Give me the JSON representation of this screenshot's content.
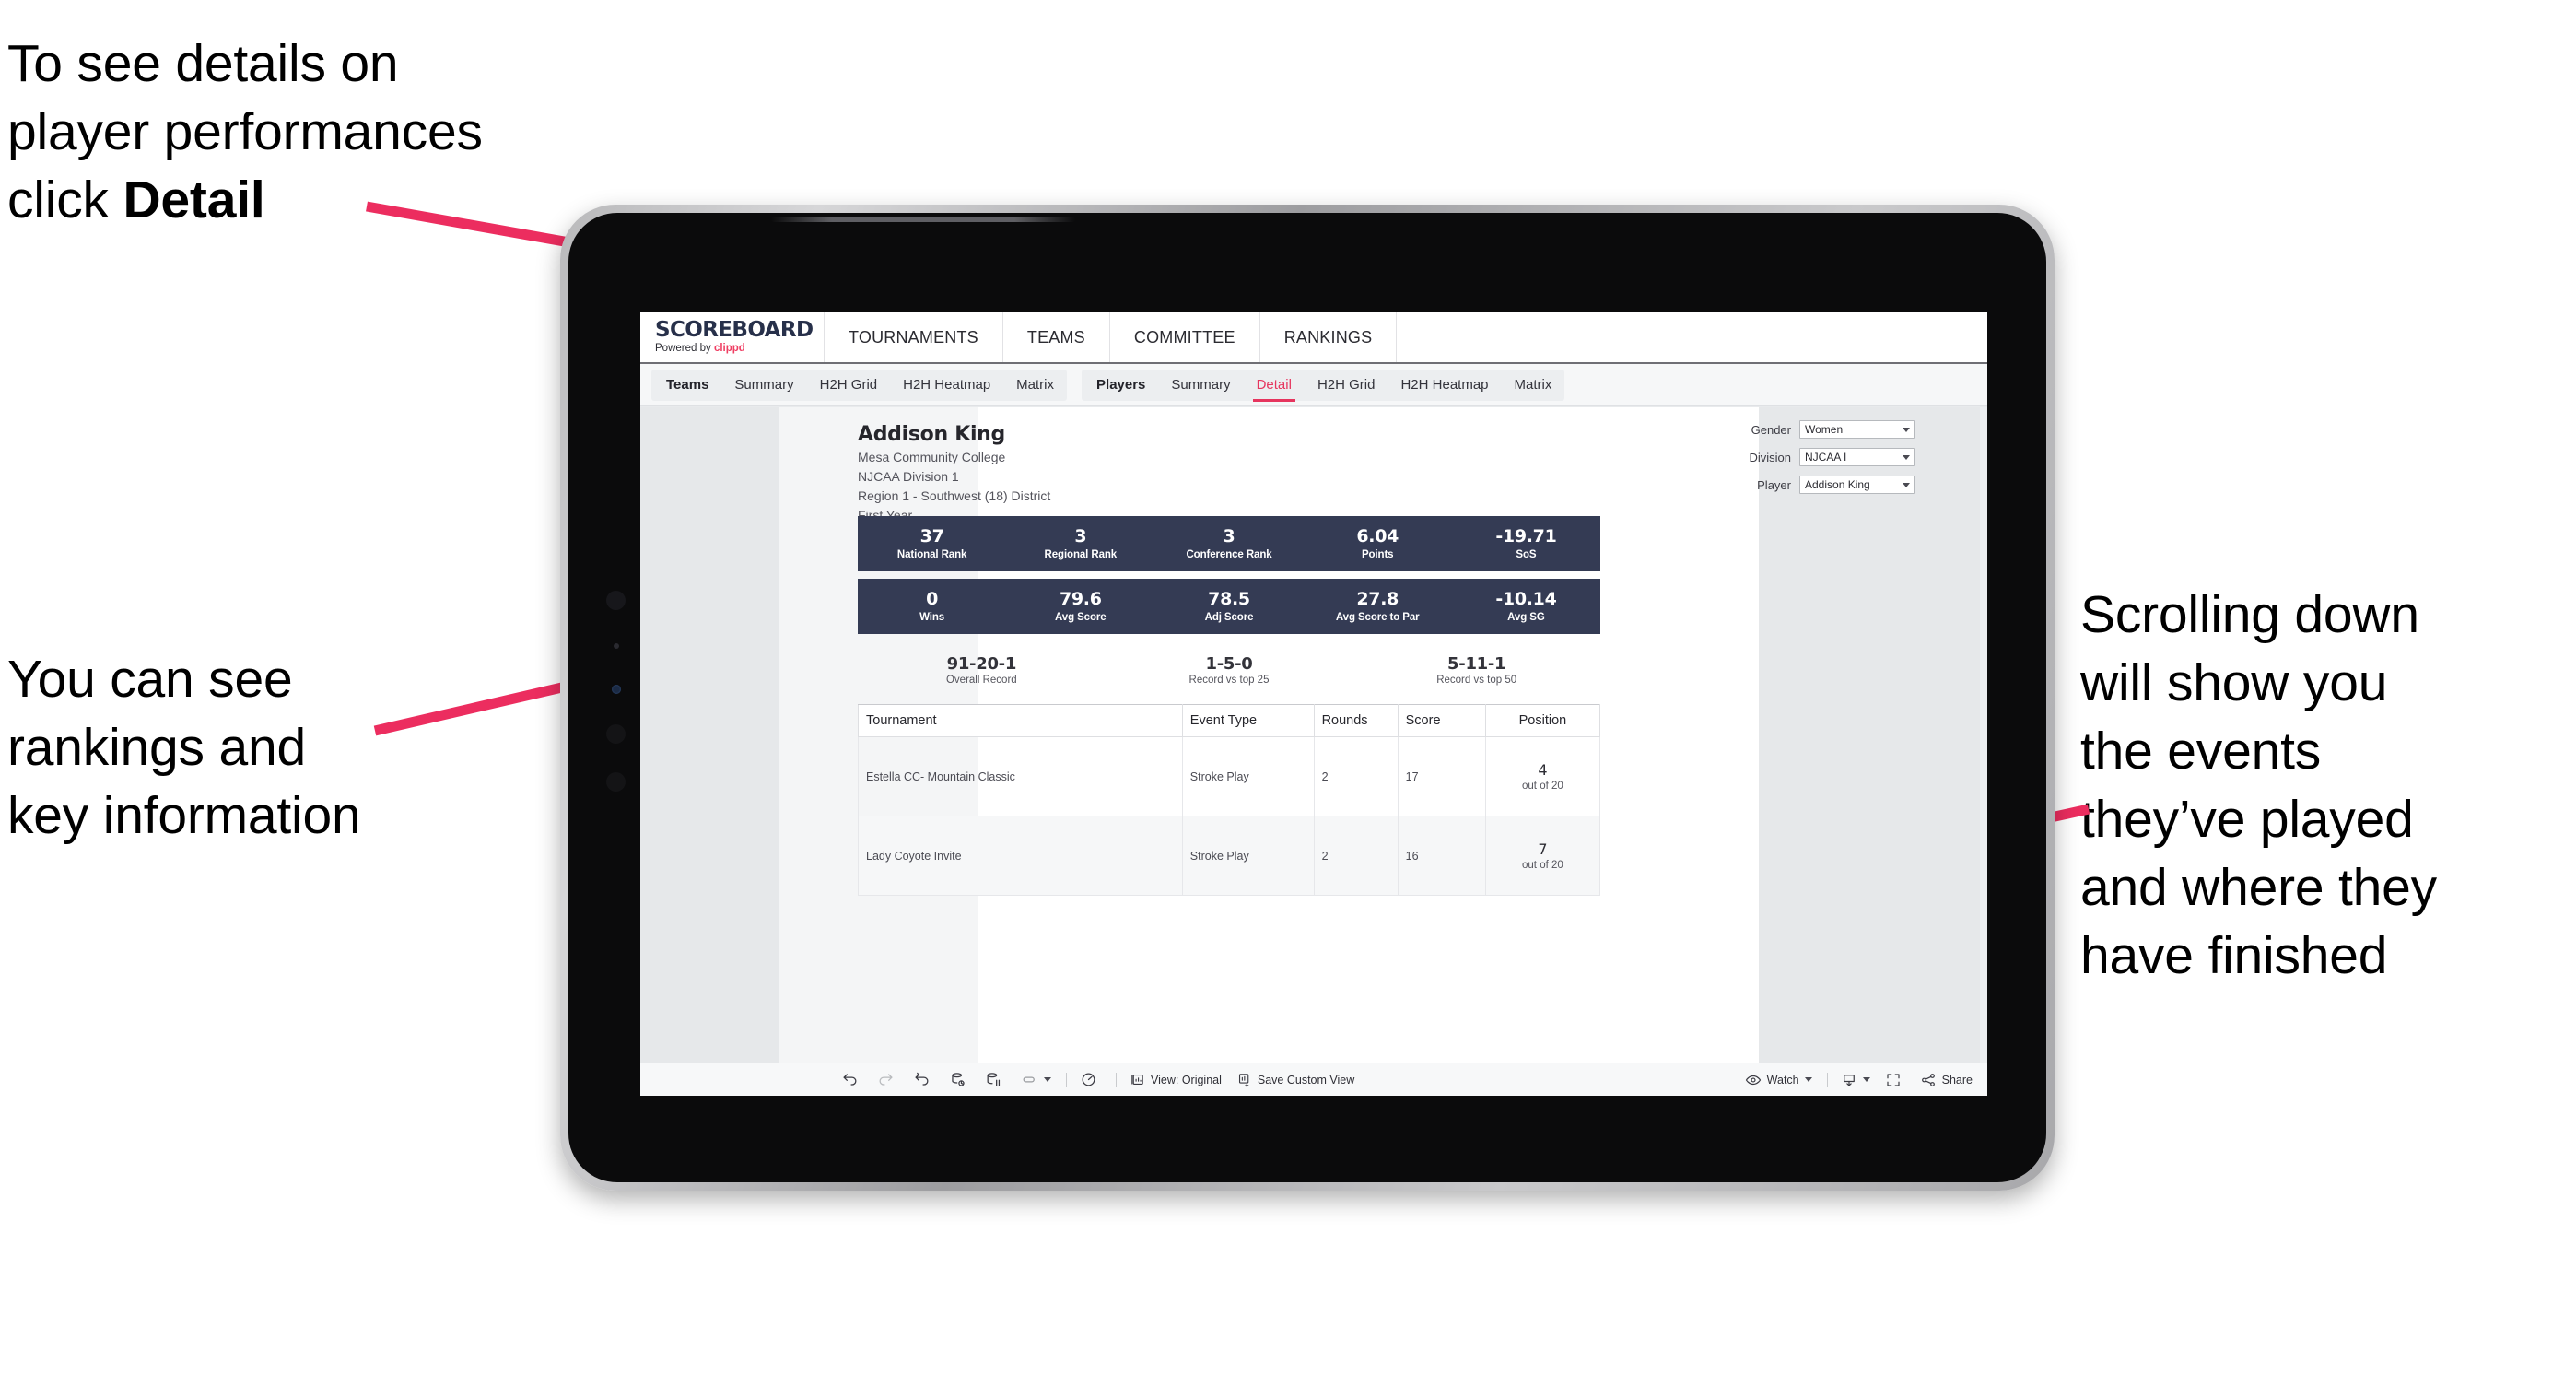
{
  "annotations": {
    "detail": {
      "line1": "To see details on",
      "line2": "player performances",
      "line3_prefix": "click ",
      "line3_bold": "Detail"
    },
    "rankings": "You can see\nrankings and\nkey information",
    "scrolling": "Scrolling down\nwill show you\nthe events\nthey’ve played\nand where they\nhave finished"
  },
  "colors": {
    "accent_pink": "#ef3e63",
    "arrow_pink": "#ec2d5f",
    "stat_bar_navy": "#343b54",
    "tab_active": "#e6355e"
  },
  "app": {
    "brand": {
      "title": "SCOREBOARD",
      "sub_prefix": "Powered by ",
      "sub_brand": "clippd"
    },
    "topnav": [
      {
        "label": "TOURNAMENTS"
      },
      {
        "label": "TEAMS"
      },
      {
        "label": "COMMITTEE"
      },
      {
        "label": "RANKINGS"
      }
    ],
    "tabbar": {
      "groups": [
        {
          "head": "Teams",
          "tabs": [
            {
              "label": "Summary",
              "active": false
            },
            {
              "label": "H2H Grid",
              "active": false
            },
            {
              "label": "H2H Heatmap",
              "active": false
            },
            {
              "label": "Matrix",
              "active": false
            }
          ]
        },
        {
          "head": "Players",
          "tabs": [
            {
              "label": "Summary",
              "active": false
            },
            {
              "label": "Detail",
              "active": true
            },
            {
              "label": "H2H Grid",
              "active": false
            },
            {
              "label": "H2H Heatmap",
              "active": false
            },
            {
              "label": "Matrix",
              "active": false
            }
          ]
        }
      ]
    },
    "player": {
      "name": "Addison King",
      "school": "Mesa Community College",
      "division": "NJCAA Division 1",
      "region": "Region 1 - Southwest (18) District",
      "year": "First Year"
    },
    "filters": [
      {
        "label": "Gender",
        "value": "Women"
      },
      {
        "label": "Division",
        "value": "NJCAA I"
      },
      {
        "label": "Player",
        "value": "Addison King"
      }
    ],
    "stats_row_1": [
      {
        "value": "37",
        "label": "National Rank"
      },
      {
        "value": "3",
        "label": "Regional Rank"
      },
      {
        "value": "3",
        "label": "Conference Rank"
      },
      {
        "value": "6.04",
        "label": "Points"
      },
      {
        "value": "-19.71",
        "label": "SoS"
      }
    ],
    "stats_row_2": [
      {
        "value": "0",
        "label": "Wins"
      },
      {
        "value": "79.6",
        "label": "Avg Score"
      },
      {
        "value": "78.5",
        "label": "Adj Score"
      },
      {
        "value": "27.8",
        "label": "Avg Score to Par"
      },
      {
        "value": "-10.14",
        "label": "Avg SG"
      }
    ],
    "records": [
      {
        "value": "91-20-1",
        "label": "Overall Record"
      },
      {
        "value": "1-5-0",
        "label": "Record vs top 25"
      },
      {
        "value": "5-11-1",
        "label": "Record vs top 50"
      }
    ],
    "tournaments_table": {
      "headers": [
        "Tournament",
        "Event Type",
        "Rounds",
        "Score",
        "Position"
      ],
      "rows": [
        {
          "tournament": "Estella CC- Mountain Classic",
          "event_type": "Stroke Play",
          "rounds": "2",
          "score": "17",
          "position_num": "4",
          "position_outof": "out of 20"
        },
        {
          "tournament": "Lady Coyote Invite",
          "event_type": "Stroke Play",
          "rounds": "2",
          "score": "16",
          "position_num": "7",
          "position_outof": "out of 20"
        }
      ]
    },
    "toolbar": {
      "undo": "undo-icon",
      "redo": "redo-icon",
      "revert": "revert-icon",
      "refresh": "refresh-data-icon",
      "pause": "pause-updates-icon",
      "subscribe": "alert-subscribe-icon",
      "view_label": "View: Original",
      "save_custom_view": "Save Custom View",
      "watch": "Watch",
      "share": "Share"
    }
  }
}
